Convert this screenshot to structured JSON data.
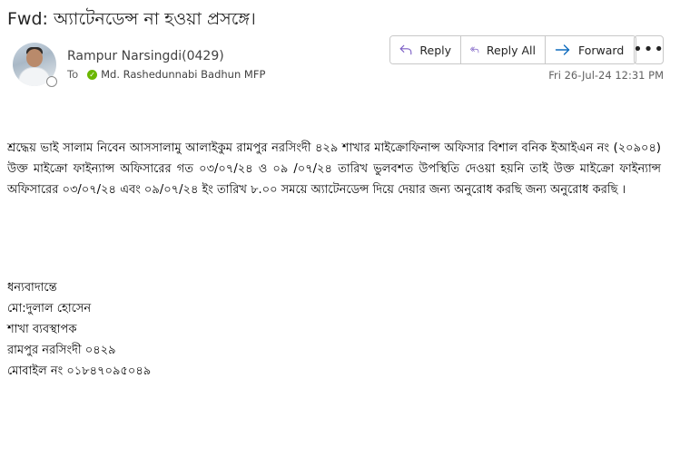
{
  "email": {
    "subject": "Fwd: অ্যাটেনডেন্স না হওয়া প্রসঙ্গে।",
    "sender": "Rampur Narsingdi(0429)",
    "to_label": "To",
    "recipient": "Md. Rashedunnabi Badhun MFP",
    "date": "Fri 26-Jul-24 12:31 PM",
    "body": "শ্রদ্ধেয় ভাই সালাম নিবেন আসসালামু আলাইকুম রামপুর নরসিংদী ৪২৯ শাখার মাইক্রোফিনান্স অফিসার বিশাল বনিক ইআইএন নং (২০৯০৪) উক্ত মাইক্রো ফাইন্যান্স অফিসারের গত ০৩/০৭/২৪ ও ০৯ /০৭/২৪ তারিখ ভুলবশত উপস্থিতি দেওয়া হয়নি তাই উক্ত মাইক্রো ফাইন্যান্স অফিসারের ০৩/০৭/২৪ এবং ০৯/০৭/২৪ ইং তারিখ ৮.০০ সময়ে অ্যাটেনডেন্স দিয়ে দেয়ার জন্য অনুরোধ করছি জন্য অনুরোধ করছি ।",
    "signature": [
      "ধন্যবাদান্তে",
      "মো:দুলাল হোসেন",
      "শাখা ব্যবস্থাপক",
      "রামপুর নরসিংদী ০৪২৯",
      "মোবাইল নং ০১৮৪৭০৯৫০৪৯"
    ]
  },
  "actions": {
    "reply": "Reply",
    "reply_all": "Reply All",
    "forward": "Forward",
    "more": "•••"
  },
  "icons": {
    "reply": "reply-icon",
    "reply_all": "reply-all-icon",
    "forward": "forward-icon",
    "more": "more-icon",
    "presence": "presence-icon",
    "status": "online-status-icon"
  },
  "colors": {
    "icon_accent": "#7a5cc4",
    "forward_accent": "#0f6cbd",
    "online": "#6bb700"
  }
}
